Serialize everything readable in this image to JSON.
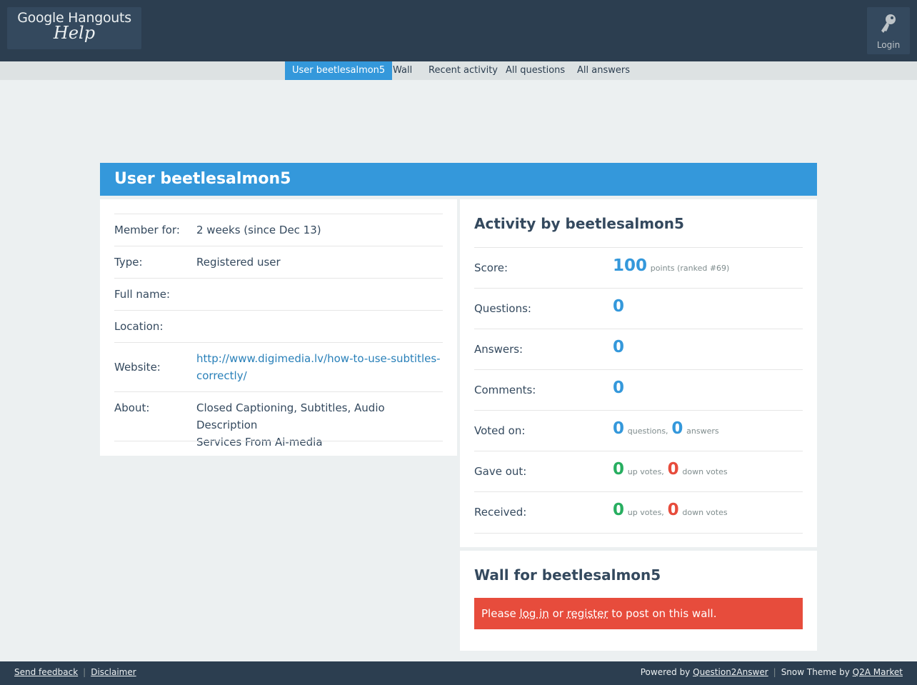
{
  "header": {
    "logo_line1": "Google Hangouts",
    "logo_line2": "Help",
    "login_label": "Login",
    "login_icon": "key-icon"
  },
  "nav": [
    "User beetlesalmon5",
    "Wall",
    "Recent activity",
    "All questions",
    "All answers"
  ],
  "page_title": "User beetlesalmon5",
  "profile": {
    "member_for_label": "Member for:",
    "member_for_value": "2 weeks (since Dec 13)",
    "type_label": "Type:",
    "type_value": "Registered user",
    "fullname_label": "Full name:",
    "location_label": "Location:",
    "website_label": "Website:",
    "website_value_1": "http://www.digimedia.lv/how-to-use-subtitles-",
    "website_value_2": "correctly/",
    "about_label": "About:",
    "about_value_1": "Closed Captioning, Subtitles, Audio Description",
    "about_value_2": "Services From Ai-media"
  },
  "activity": {
    "title": "Activity by beetlesalmon5",
    "score_label": "Score:",
    "score_value": "100",
    "score_note": "points (ranked #69)",
    "questions_label": "Questions:",
    "questions_value": "0",
    "answers_label": "Answers:",
    "answers_value": "0",
    "comments_label": "Comments:",
    "comments_value": "0",
    "voted_label": "Voted on:",
    "voted_q": "0",
    "voted_q_note": "questions,",
    "voted_a": "0",
    "voted_a_note": "answers",
    "gave_label": "Gave out:",
    "gave_up": "0",
    "gave_up_note": "up votes,",
    "gave_down": "0",
    "gave_down_note": "down votes",
    "recv_label": "Received:",
    "recv_up": "0",
    "recv_up_note": "up votes,",
    "recv_down": "0",
    "recv_down_note": "down votes"
  },
  "wall": {
    "title": "Wall for beetlesalmon5",
    "alert_pre": "Please",
    "alert_login": "log in",
    "alert_or": "or",
    "alert_register": "register",
    "alert_post": "to post on this wall."
  },
  "footer": {
    "send_feedback": "Send feedback",
    "disclaimer": "Disclaimer",
    "powered_by": "Powered by",
    "q2a": "Question2Answer",
    "snow_theme": "Snow Theme by",
    "q2a_market": "Q2A Market"
  },
  "colors": {
    "topbar": "#2c3e50",
    "accent": "#3498db",
    "green": "#27ae60",
    "red": "#e74c3c",
    "background": "#ecf0f1"
  }
}
